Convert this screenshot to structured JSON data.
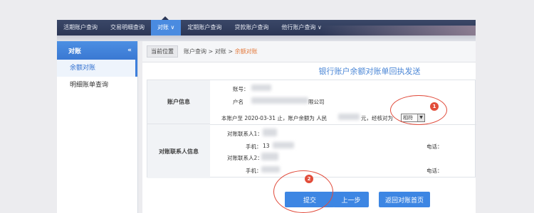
{
  "topnav": {
    "items": [
      {
        "label": "活期账户查询"
      },
      {
        "label": "交易明细查询"
      },
      {
        "label": "对账 ∨"
      },
      {
        "label": "定期账户查询"
      },
      {
        "label": "贷款账户查询"
      },
      {
        "label": "他行账户查询 ∨"
      }
    ]
  },
  "sidebar": {
    "title": "对账",
    "collapse_icon": "«",
    "items": [
      {
        "label": "余额对账"
      },
      {
        "label": "明细账单查询"
      }
    ]
  },
  "breadcrumb": {
    "current_label": "当前位置",
    "path": "账户查询 > 对账 > ",
    "last": "余额对账"
  },
  "page_title": "银行账户余额对账单回执发送",
  "account_info": {
    "section_label": "账户信息",
    "account_no_label": "账号：",
    "account_name_label": "户名",
    "account_name_suffix": "限公司",
    "balance_prefix": "本账户至 2020-03-31 止，账户余额为 人民",
    "balance_suffix": "元，经核对为",
    "check_select_value": "相符"
  },
  "contacts": {
    "section_label": "对账联系人信息",
    "contact1_label": "对账联系人1：",
    "mobile1_label": "手机：",
    "mobile1_value": "13",
    "phone1_label": "电话：",
    "contact2_label": "对账联系人2：",
    "mobile2_label": "手机：",
    "phone2_label": "电话："
  },
  "buttons": {
    "submit": "提交",
    "prev": "上一步",
    "back": "返回对账首页"
  },
  "annotations": {
    "mark1": "1",
    "mark2": "2"
  },
  "colors": {
    "nav_bg": "#2c3756",
    "accent": "#3d86e3",
    "highlight": "#e4793b",
    "annotation_red": "#e14b3b"
  }
}
